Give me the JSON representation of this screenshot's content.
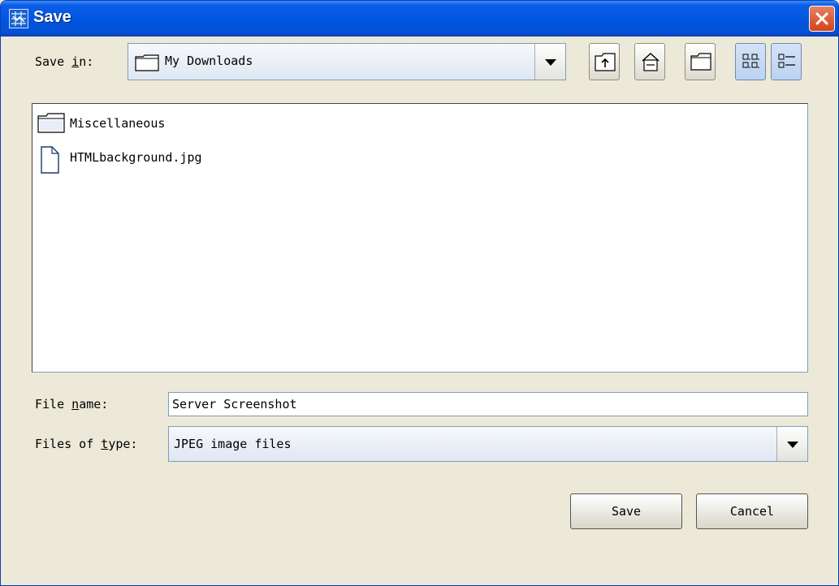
{
  "window": {
    "title": "Save"
  },
  "save_in": {
    "label_pre": "Save ",
    "label_mnemonic": "i",
    "label_post": "n:",
    "value": "My Downloads"
  },
  "toolbar": {
    "up_icon": "up-folder-icon",
    "home_icon": "home-icon",
    "new_folder_icon": "new-folder-icon",
    "list_icon": "list-view-icon",
    "details_icon": "details-view-icon"
  },
  "files": [
    {
      "name": "Miscellaneous",
      "type": "folder"
    },
    {
      "name": "HTMLbackground.jpg",
      "type": "file"
    }
  ],
  "file_name": {
    "label_pre": "File ",
    "label_mnemonic": "n",
    "label_post": "ame:",
    "value": "Server Screenshot"
  },
  "file_type": {
    "label_pre": "Files of ",
    "label_mnemonic": "t",
    "label_post": "ype:",
    "value": "JPEG image files"
  },
  "buttons": {
    "save": "Save",
    "cancel": "Cancel"
  },
  "colors": {
    "titlebar": "#0256df",
    "window_bg": "#ece9d8",
    "close": "#d44318"
  }
}
